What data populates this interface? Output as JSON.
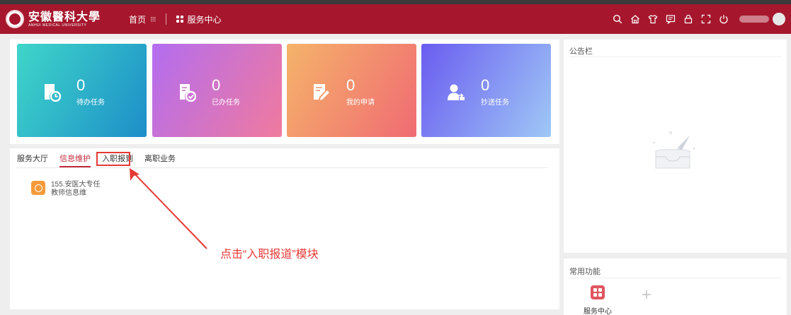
{
  "header": {
    "logo_cn": "安徽醫科大學",
    "logo_en": "ANHUI MEDICAL UNIVERSITY",
    "nav_home": "首页",
    "nav_service": "服务中心",
    "tools": [
      "search-icon",
      "home-icon",
      "shirt-icon",
      "message-icon",
      "lock-icon",
      "fullscreen-icon",
      "power-icon"
    ]
  },
  "stats": [
    {
      "count": "0",
      "label": "待办任务",
      "icon": "clock-doc-icon",
      "gradient": [
        "#3fd6c9",
        "#1d8ec9"
      ]
    },
    {
      "count": "0",
      "label": "已办任务",
      "icon": "check-doc-icon",
      "gradient": [
        "#b36df0",
        "#f07a9e"
      ]
    },
    {
      "count": "0",
      "label": "我的申请",
      "icon": "edit-doc-icon",
      "gradient": [
        "#f5b36a",
        "#f06b73"
      ]
    },
    {
      "count": "0",
      "label": "抄送任务",
      "icon": "user-share-icon",
      "gradient": [
        "#6a5cf0",
        "#9fc8f6"
      ]
    }
  ],
  "hall": {
    "title": "服务大厅",
    "tabs": [
      "信息维护",
      "入职报到",
      "离职业务"
    ],
    "active_tab": "信息维护",
    "item_text": "155.安医大专任教师信息维"
  },
  "annotation": "点击“入职报道”模块",
  "notice": {
    "title": "公告栏"
  },
  "favorites": {
    "title": "常用功能",
    "item_label": "服务中心"
  },
  "colors": {
    "brand": "#a6172d",
    "accent": "#c2293b",
    "annotation": "#e53935"
  }
}
